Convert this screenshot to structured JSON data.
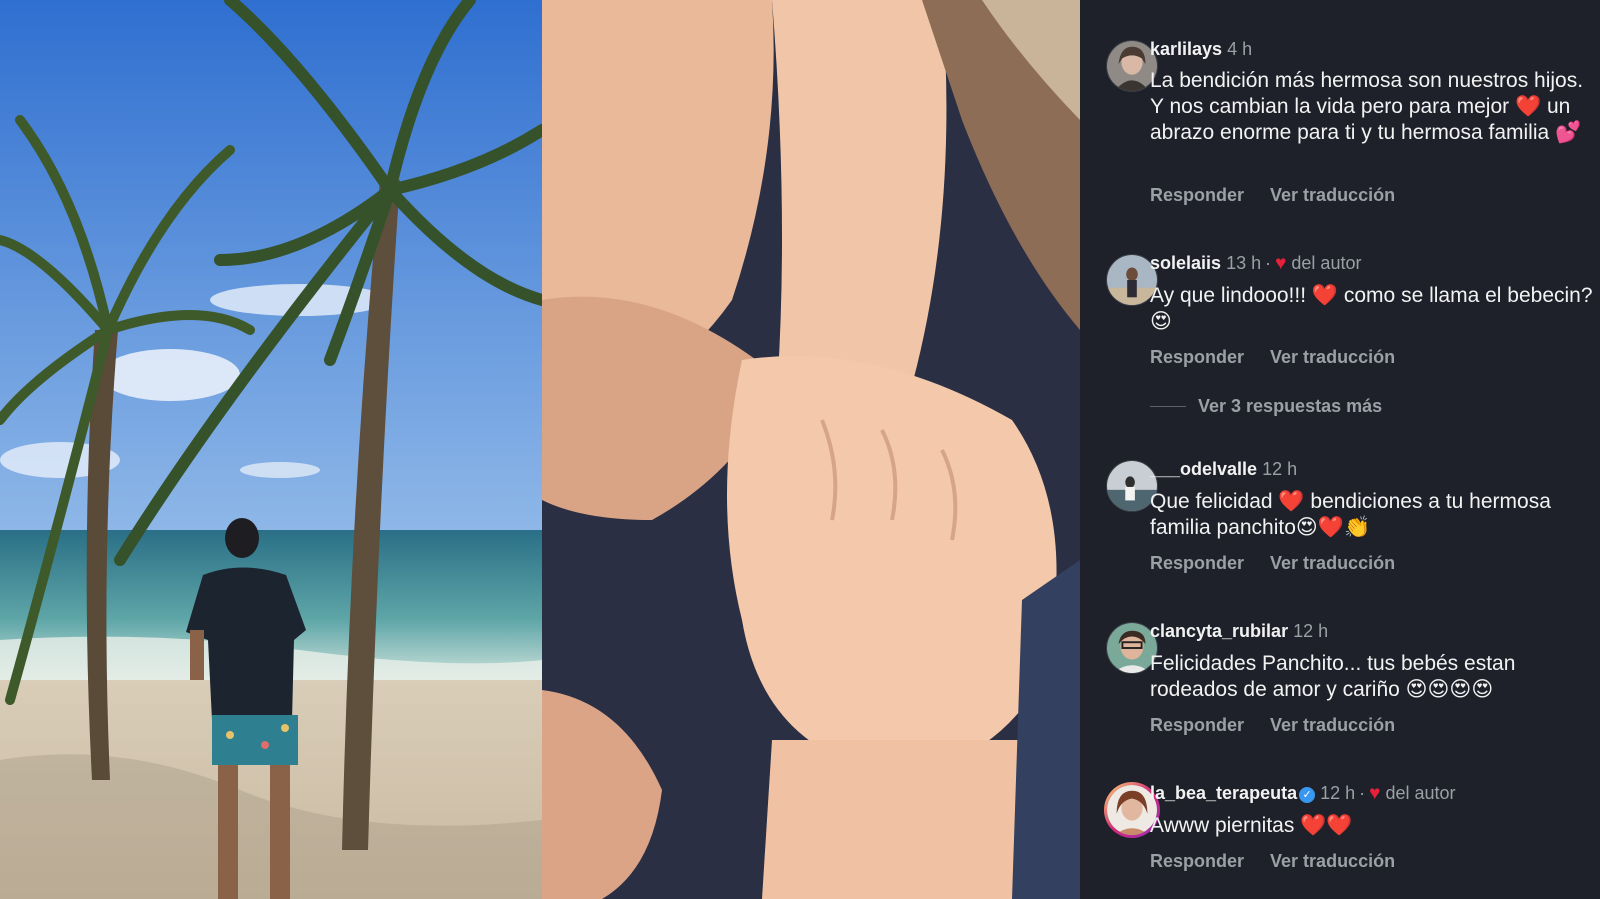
{
  "comments": [
    {
      "user": "karlilays",
      "time": "4 h",
      "author_like": "",
      "text": "La bendición más hermosa son nuestros hijos. Y nos cambian la vida pero para mejor ❤️ un abrazo enorme para ti y tu hermosa familia 💕",
      "reply": "Responder",
      "translate": "Ver traducción"
    },
    {
      "user": "solelaiis",
      "time": "13 h",
      "author_like": "del autor",
      "text": "Ay que lindooo!!! ❤️ como se llama el bebecin? 😍",
      "reply": "Responder",
      "translate": "Ver traducción",
      "more_replies": "Ver 3 respuestas más"
    },
    {
      "user": "___odelvalle",
      "time": "12 h",
      "author_like": "",
      "text": "Que felicidad ❤️ bendiciones a tu hermosa familia panchito😍❤️👏",
      "reply": "Responder",
      "translate": "Ver traducción"
    },
    {
      "user": "clancyta_rubilar",
      "time": "12 h",
      "author_like": "",
      "text": "Felicidades Panchito... tus bebés estan rodeados de amor y cariño 😍😍😍😍",
      "reply": "Responder",
      "translate": "Ver traducción"
    },
    {
      "user": "la_bea_terapeuta",
      "time": "12 h",
      "author_like": "del autor",
      "verified": true,
      "text": "Awww piernitas ❤️❤️",
      "reply": "Responder",
      "translate": "Ver traducción"
    }
  ],
  "colors": {
    "panel_bg": "#1e2129",
    "secondary_text": "#9aa0a6",
    "heart": "#e8203a",
    "verified": "#3897f0"
  },
  "icons": [
    "heart-icon",
    "verified-badge-icon"
  ]
}
